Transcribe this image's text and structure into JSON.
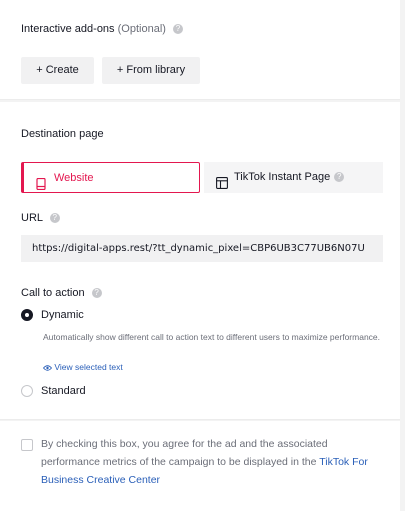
{
  "addons": {
    "title": "Interactive add-ons",
    "optional": "(Optional)",
    "create_label": "+ Create",
    "library_label": "+ From library"
  },
  "destination": {
    "title": "Destination page",
    "options": [
      {
        "label": "Website",
        "icon": "mobile-page-icon",
        "selected": true
      },
      {
        "label": "TikTok Instant Page",
        "icon": "instant-page-icon",
        "selected": false
      }
    ]
  },
  "url": {
    "label": "URL",
    "value": "https://digital-apps.rest/?tt_dynamic_pixel=CBP6UB3C77UB6N07U"
  },
  "cta": {
    "label": "Call to action",
    "dynamic_label": "Dynamic",
    "dynamic_description": "Automatically show different call to action text to different users to maximize performance.",
    "view_selected": "View selected text",
    "standard_label": "Standard",
    "selected": "Dynamic"
  },
  "consent": {
    "text": "By checking this box, you agree for the ad and the associated performance metrics of the campaign to be displayed in the",
    "link": "TikTok For Business Creative Center",
    "checked": false
  },
  "colors": {
    "accent": "#e3174f",
    "link": "#2a5fb8",
    "muted": "#6b6e78"
  }
}
